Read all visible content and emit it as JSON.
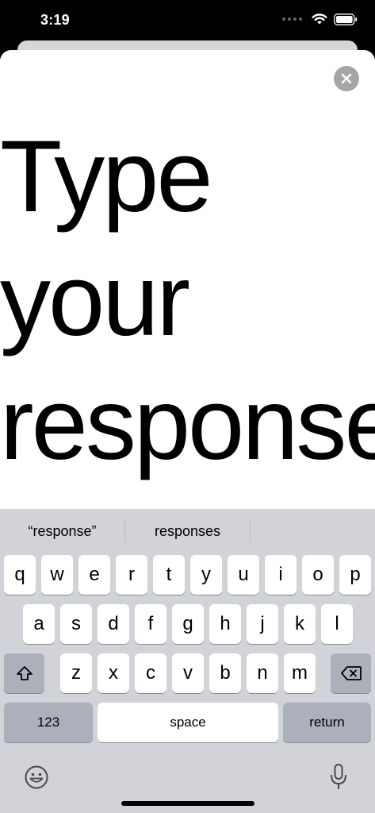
{
  "status_bar": {
    "time": "3:19",
    "icons": [
      "signal-dots-icon",
      "wifi-icon",
      "battery-icon"
    ]
  },
  "modal": {
    "close_icon": "close-icon",
    "prompt_text": "Type\nyour\nresponse"
  },
  "keyboard": {
    "suggestions": [
      "“response”",
      "responses",
      ""
    ],
    "row1": [
      "q",
      "w",
      "e",
      "r",
      "t",
      "y",
      "u",
      "i",
      "o",
      "p"
    ],
    "row2": [
      "a",
      "s",
      "d",
      "f",
      "g",
      "h",
      "j",
      "k",
      "l"
    ],
    "row3": [
      "z",
      "x",
      "c",
      "v",
      "b",
      "n",
      "m"
    ],
    "shift_icon": "shift-icon",
    "delete_icon": "delete-icon",
    "numbers_label": "123",
    "space_label": "space",
    "return_label": "return",
    "emoji_icon": "emoji-icon",
    "mic_icon": "microphone-icon"
  },
  "colors": {
    "keyboard_bg": "#d1d3d9",
    "key_bg": "#ffffff",
    "special_key_bg": "#abb0bb",
    "close_button_bg": "#a5a5a8"
  }
}
